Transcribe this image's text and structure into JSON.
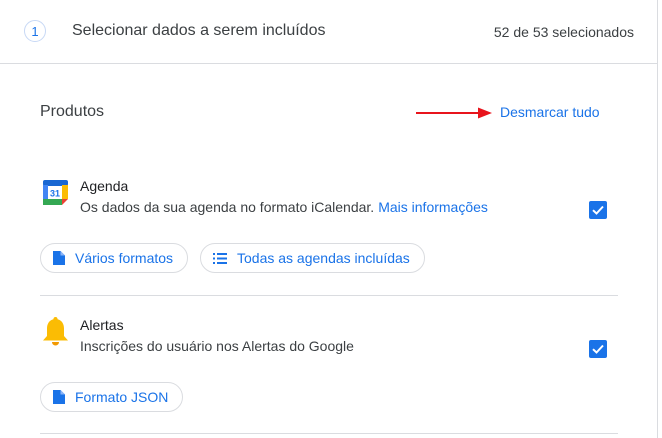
{
  "step": {
    "number": "1",
    "title": "Selecionar dados a serem incluídos",
    "count": "52 de 53 selecionados"
  },
  "products_header": {
    "label": "Produtos",
    "deselect_all": "Desmarcar tudo",
    "annotation_arrow_color": "#e8141c"
  },
  "products": [
    {
      "name": "Agenda",
      "icon": "google-calendar-icon",
      "icon_text": "31",
      "description": "Os dados da sua agenda no formato iCalendar.",
      "more_link": "Mais informações",
      "checked": true,
      "chips": [
        {
          "label": "Vários formatos",
          "icon": "file-icon"
        },
        {
          "label": "Todas as agendas incluídas",
          "icon": "list-icon"
        }
      ]
    },
    {
      "name": "Alertas",
      "icon": "bell-icon",
      "description": "Inscrições do usuário nos Alertas do Google",
      "checked": true,
      "chips": [
        {
          "label": "Formato JSON",
          "icon": "file-icon"
        }
      ]
    }
  ],
  "colors": {
    "accent": "#1a73e8",
    "text": "#3c4043",
    "divider": "#dadce0",
    "bell": "#fbbc04"
  }
}
